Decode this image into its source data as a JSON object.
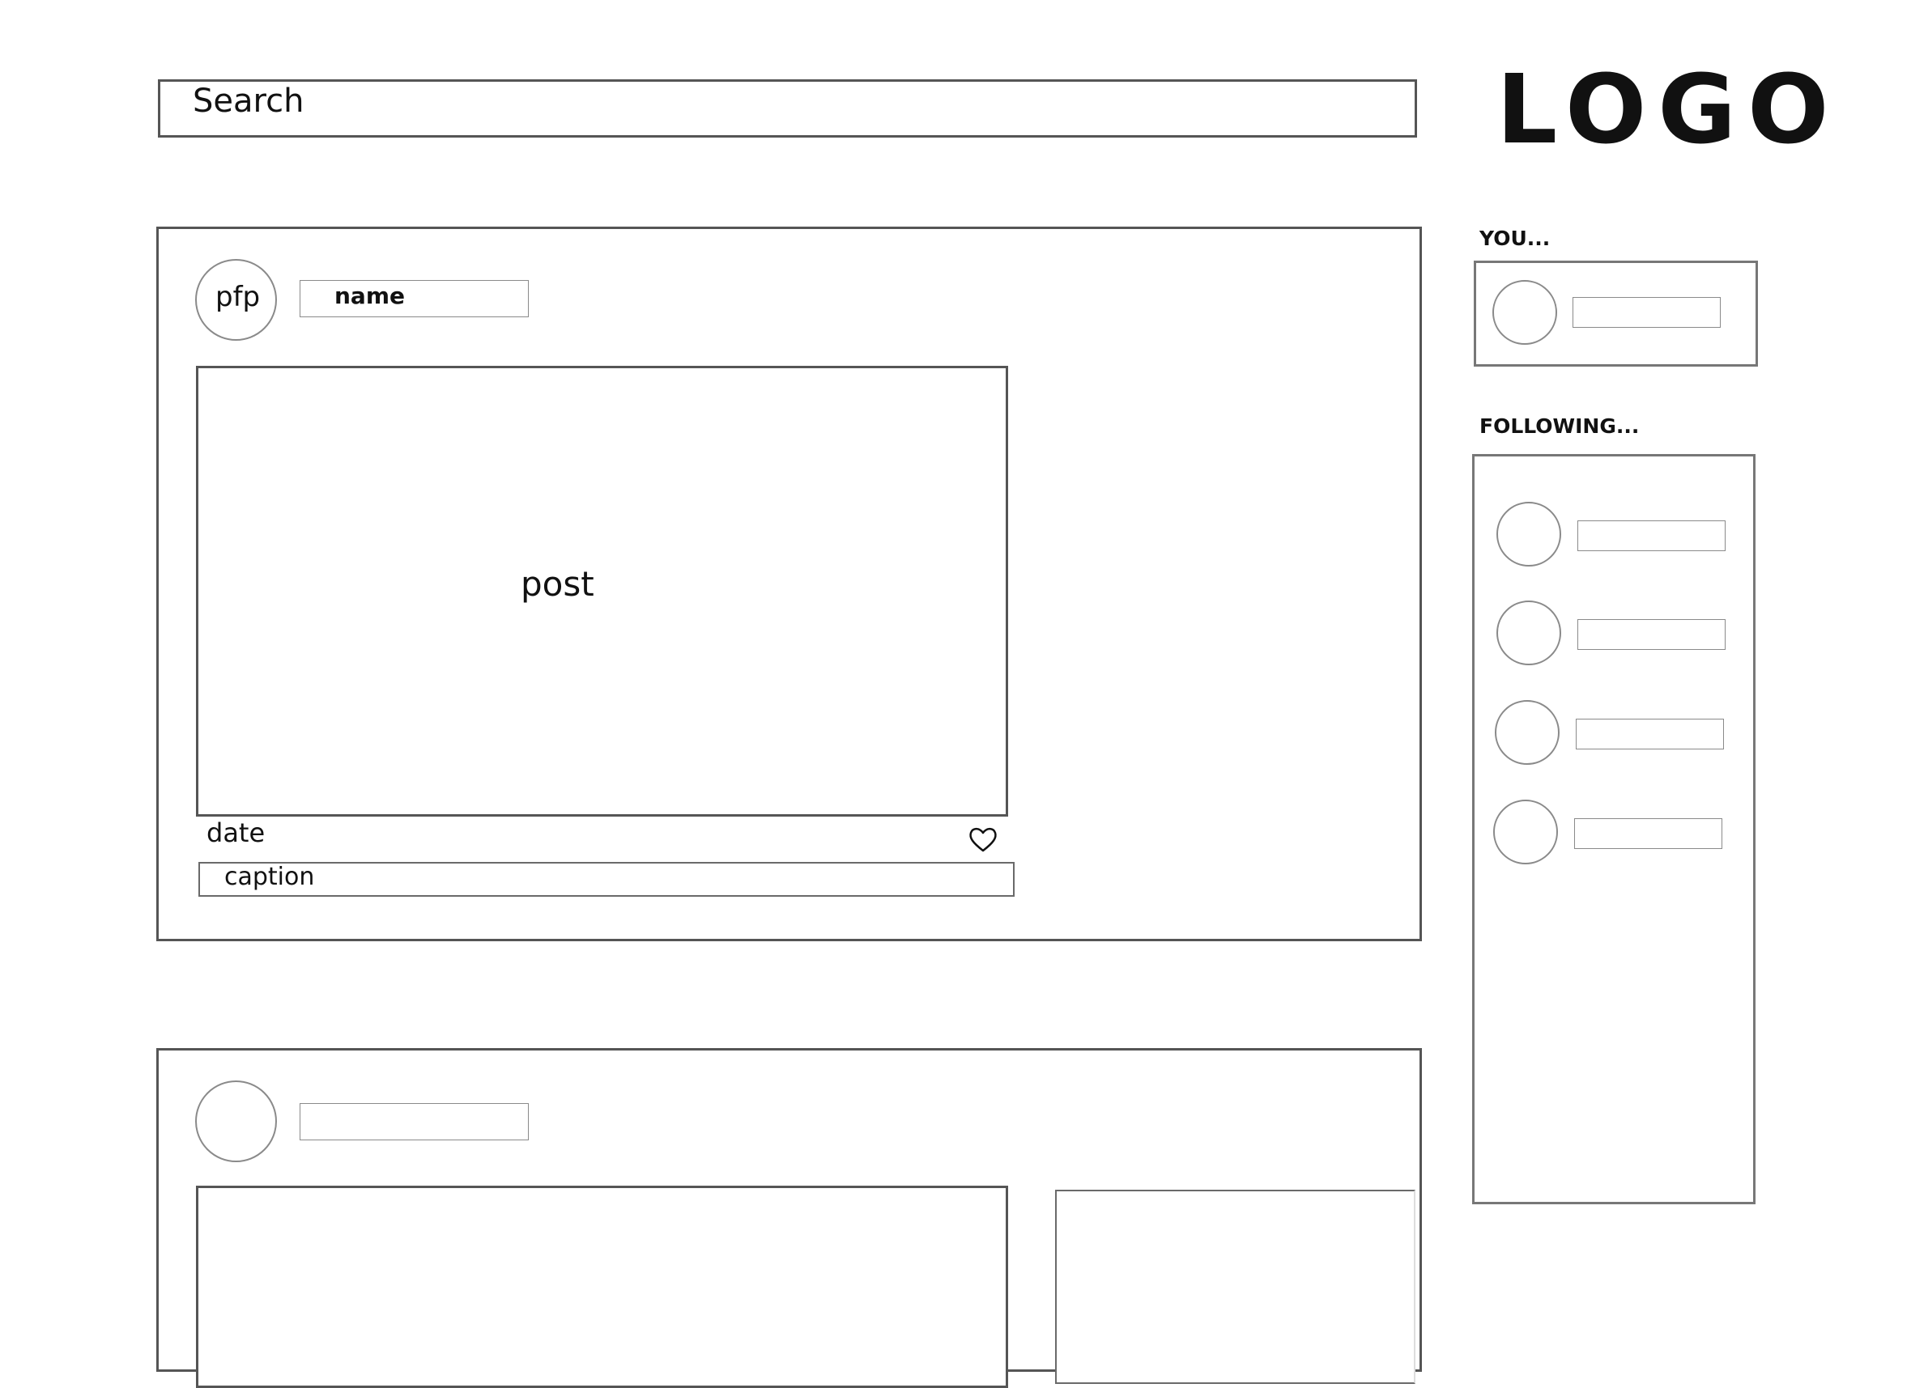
{
  "header": {
    "search_placeholder": "Search",
    "logo": "LOGO"
  },
  "feed": {
    "posts": [
      {
        "pfp_label": "pfp",
        "name_label": "name",
        "post_label": "post",
        "date_label": "date",
        "caption_label": "caption"
      }
    ]
  },
  "sidebar": {
    "you_heading": "YOU...",
    "following_heading": "FOLLOWING..."
  }
}
